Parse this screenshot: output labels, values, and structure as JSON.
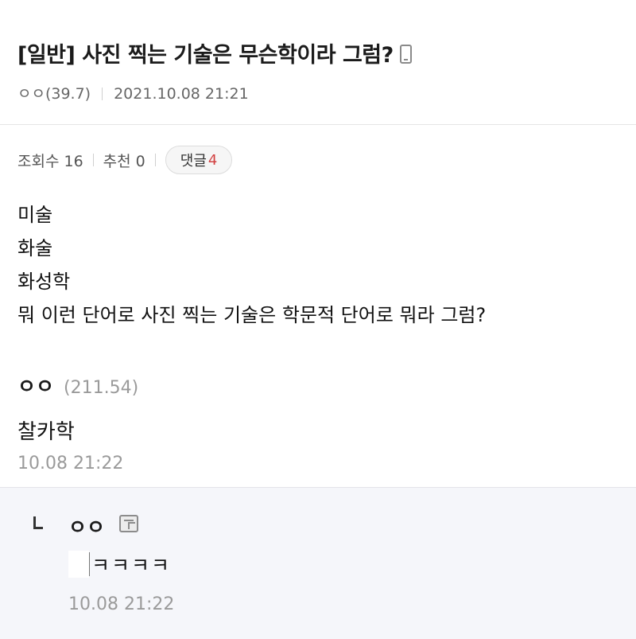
{
  "post": {
    "title": "[일반] 사진 찍는 기술은 무슨학이라 그럼?",
    "author_ip": "ㅇㅇ(39.7)",
    "datetime": "2021.10.08 21:21",
    "stats": {
      "views_label": "조회수 16",
      "recommend_label": "추천 0",
      "comments_label": "댓글",
      "comments_count": "4"
    },
    "body_lines": [
      "미술",
      "화술",
      "화성학",
      "뭐 이런 단어로 사진 찍는 기술은 학문적 단어로 뭐라 그럼?"
    ]
  },
  "comment": {
    "author": "ㅇㅇ",
    "ip": "(211.54)",
    "text": "찰카학",
    "time": "10.08 21:22"
  },
  "reply": {
    "author": "ㅇㅇ",
    "text": "ㅋㅋㅋㅋ",
    "time": "10.08 21:22"
  },
  "icons": {
    "mobile": "phone-icon",
    "memo": "memo-icon",
    "reply_marker": "reply-arrow-icon"
  },
  "colors": {
    "comment_count": "#d24141",
    "reply_background": "#f5f6fa",
    "meta_text": "#666666"
  }
}
